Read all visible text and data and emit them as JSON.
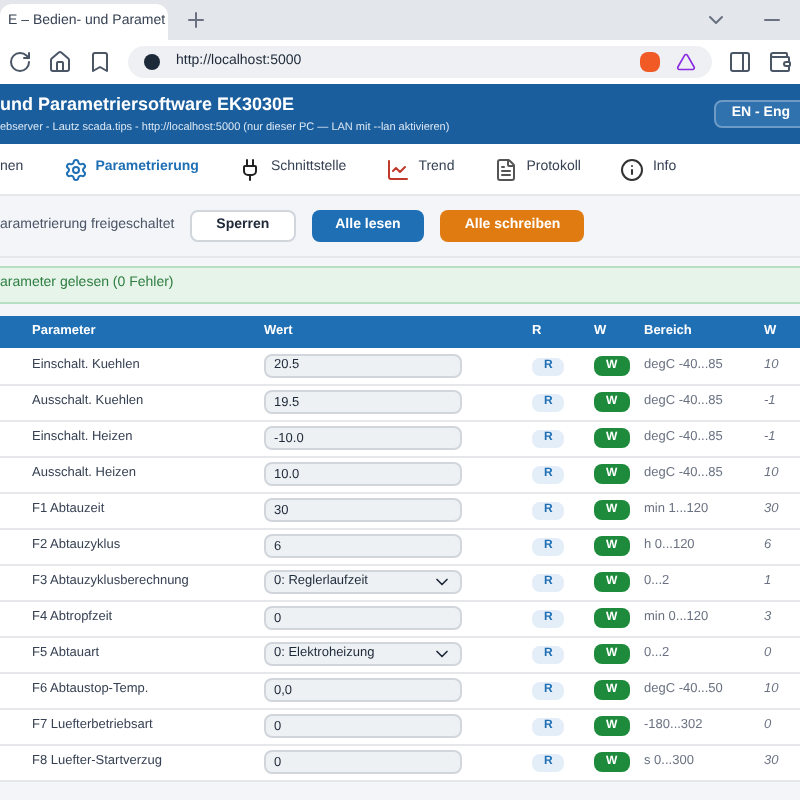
{
  "browser": {
    "tab_title": "E – Bedien- und Paramet",
    "url": "http://localhost:5000"
  },
  "header": {
    "title": "und Parametriersoftware EK3030E",
    "subtitle": "ebserver - Lautz scada.tips - http://localhost:5000 (nur dieser PC — LAN mit --lan aktivieren)",
    "language_button": "EN - Eng"
  },
  "tabs": [
    {
      "label": "nen",
      "selected": false
    },
    {
      "label": "Parametrierung",
      "selected": true
    },
    {
      "label": "Schnittstelle",
      "selected": false
    },
    {
      "label": "Trend",
      "selected": false
    },
    {
      "label": "Protokoll",
      "selected": false
    },
    {
      "label": "Info",
      "selected": false
    }
  ],
  "toolbar": {
    "status": "arametrierung freigeschaltet",
    "buttons": [
      {
        "kind": "plain",
        "label": "Sperren"
      },
      {
        "kind": "primary",
        "label": "Alle lesen"
      },
      {
        "kind": "warning",
        "label": "Alle schreiben"
      }
    ]
  },
  "message": "arameter gelesen (0 Fehler)",
  "table": {
    "columns": [
      "Parameter",
      "Wert",
      "R",
      "W",
      "Bereich",
      "W"
    ],
    "rows": [
      {
        "name": "Einschalt. Kuehlen",
        "kind": "input",
        "value": "20.5",
        "r": "R",
        "w": "W",
        "range": "degC -40...85",
        "default": "10"
      },
      {
        "name": "Ausschalt. Kuehlen",
        "kind": "input",
        "value": "19.5",
        "r": "R",
        "w": "W",
        "range": "degC -40...85",
        "default": "-1"
      },
      {
        "name": "Einschalt. Heizen",
        "kind": "input",
        "value": "-10.0",
        "r": "R",
        "w": "W",
        "range": "degC -40...85",
        "default": "-1"
      },
      {
        "name": "Ausschalt. Heizen",
        "kind": "input",
        "value": "10.0",
        "r": "R",
        "w": "W",
        "range": "degC -40...85",
        "default": "10"
      },
      {
        "name": "F1 Abtauzeit",
        "kind": "input",
        "value": "30",
        "r": "R",
        "w": "W",
        "range": "min 1...120",
        "default": "30"
      },
      {
        "name": "F2 Abtauzyklus",
        "kind": "input",
        "value": "6",
        "r": "R",
        "w": "W",
        "range": "h 0...120",
        "default": "6"
      },
      {
        "name": "F3 Abtauzyklusberechnung",
        "kind": "select",
        "value": "0: Reglerlaufzeit",
        "r": "R",
        "w": "W",
        "range": "0...2",
        "default": "1"
      },
      {
        "name": "F4 Abtropfzeit",
        "kind": "input",
        "value": "0",
        "r": "R",
        "w": "W",
        "range": "min 0...120",
        "default": "3"
      },
      {
        "name": "F5 Abtauart",
        "kind": "select",
        "value": "0: Elektroheizung",
        "r": "R",
        "w": "W",
        "range": "0...2",
        "default": "0"
      },
      {
        "name": "F6 Abtaustop-Temp.",
        "kind": "input",
        "value": "0,0",
        "r": "R",
        "w": "W",
        "range": "degC -40...50",
        "default": "10"
      },
      {
        "name": "F7 Luefterbetriebsart",
        "kind": "input",
        "value": "0",
        "r": "R",
        "w": "W",
        "range": "-180...302",
        "default": "0"
      },
      {
        "name": "F8 Luefter-Startverzug",
        "kind": "input",
        "value": "0",
        "r": "R",
        "w": "W",
        "range": "s 0...300",
        "default": "30"
      }
    ]
  }
}
